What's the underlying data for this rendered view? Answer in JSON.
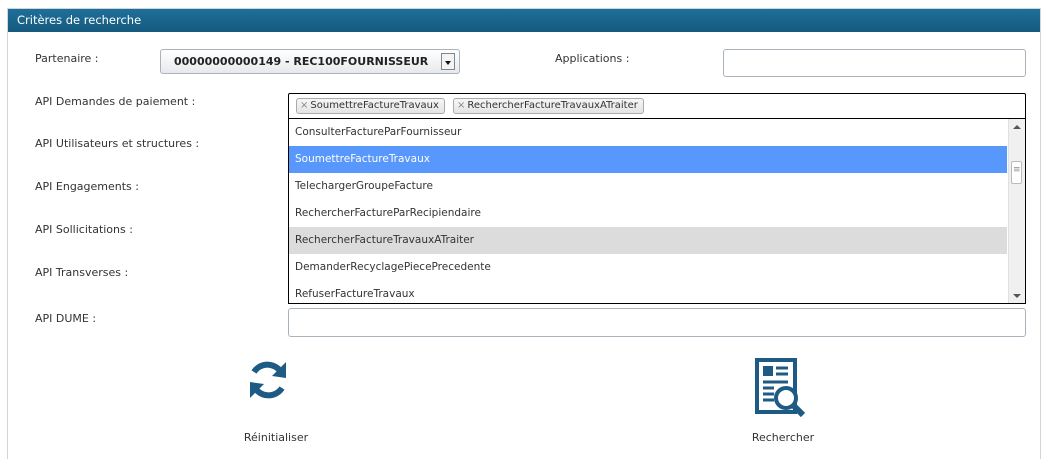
{
  "panel": {
    "title": "Critères de recherche"
  },
  "fields": {
    "partenaire_label": "Partenaire :",
    "partenaire_value": "00000000000149 - REC100FOURNISSEUR",
    "applications_label": "Applications :",
    "applications_value": "",
    "demandes_paiement_label": "API Demandes de paiement :",
    "utilisateurs_label": "API Utilisateurs et structures :",
    "engagements_label": "API Engagements :",
    "sollicitations_label": "API Sollicitations :",
    "transverses_label": "API Transverses :",
    "dume_label": "API DUME :",
    "dume_value": ""
  },
  "selected_tags": [
    "SoumettreFactureTravaux",
    "RechercherFactureTravauxATraiter"
  ],
  "dropdown_options": [
    "ConsulterFactureParFournisseur",
    "SoumettreFactureTravaux",
    "TelechargerGroupeFacture",
    "RechercherFactureParRecipiendaire",
    "RechercherFactureTravauxATraiter",
    "DemanderRecyclagePiecePrecedente",
    "RefuserFactureTravaux"
  ],
  "tag_remove_glyph": "×",
  "actions": {
    "reset_label": "Réinitialiser",
    "search_label": "Rechercher"
  },
  "colors": {
    "header": "#1a6690",
    "accent": "#1d5a84",
    "selected_option": "#5897fb",
    "hovered_option": "#dcdcdc"
  },
  "icons": {
    "reset": "refresh-icon",
    "search": "document-search-icon"
  }
}
